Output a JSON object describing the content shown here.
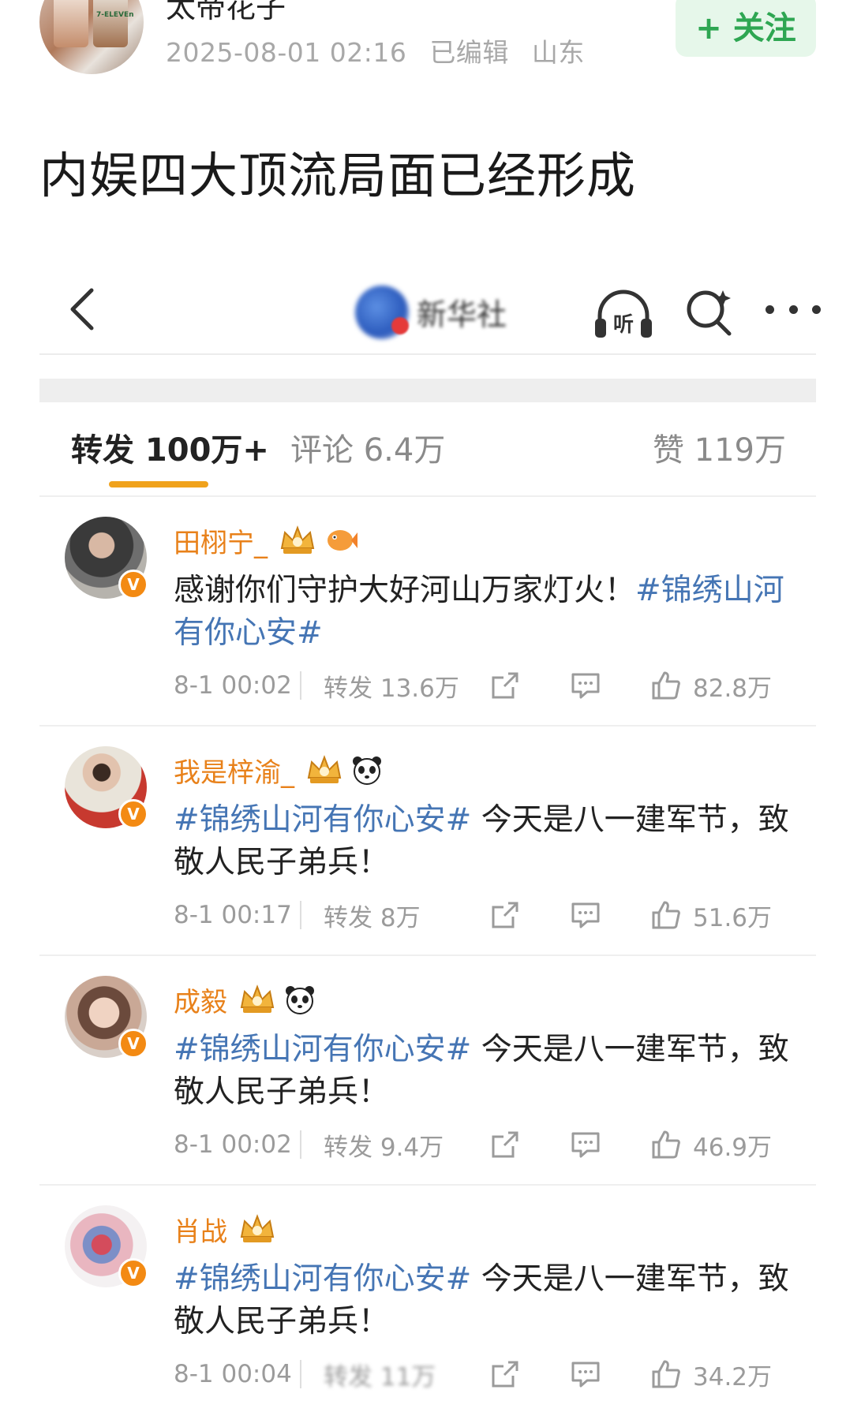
{
  "post": {
    "author_name": "太帝花子",
    "date": "2025-08-01 02:16",
    "edited": "已编辑",
    "location": "山东",
    "follow_label": "+ 关注",
    "title": "内娱四大顶流局面已经形成",
    "avatar_cup_label": "7-ELEVEn"
  },
  "screenshot": {
    "nav": {
      "back_icon": "chevron-left-icon",
      "account_name": "新华社",
      "listen_label": "听",
      "search_icon": "search-sparkle-icon",
      "more_icon": "more-dots-icon"
    },
    "tabs": [
      {
        "label": "转发 100万+",
        "active": true
      },
      {
        "label": "评论 6.4万",
        "active": false
      },
      {
        "label": "赞 119万",
        "active": false
      }
    ],
    "accent_color": "#f0a21c",
    "forwards": [
      {
        "name": "田栩宁_",
        "badges": [
          "crown-icon",
          "fish-icon"
        ],
        "hashtag_first": false,
        "text_before": "感谢你们守护大好河山万家灯火！",
        "hashtag": "#锦绣山河有你心安#",
        "text_after": "",
        "time": "8-1 00:02",
        "reposts": "转发 13.6万",
        "likes": "82.8万"
      },
      {
        "name": "我是梓渝_",
        "badges": [
          "crown-icon",
          "panda-icon"
        ],
        "hashtag_first": true,
        "text_before": "",
        "hashtag": "#锦绣山河有你心安#",
        "text_after": " 今天是八一建军节，致敬人民子弟兵！",
        "time": "8-1 00:17",
        "reposts": "转发 8万",
        "likes": "51.6万"
      },
      {
        "name": "成毅",
        "badges": [
          "crown-icon",
          "panda-icon"
        ],
        "hashtag_first": true,
        "text_before": "",
        "hashtag": "#锦绣山河有你心安#",
        "text_after": " 今天是八一建军节，致敬人民子弟兵！",
        "time": "8-1 00:02",
        "reposts": "转发 9.4万",
        "likes": "46.9万"
      },
      {
        "name": "肖战",
        "badges": [
          "crown-icon"
        ],
        "hashtag_first": true,
        "text_before": "",
        "hashtag": "#锦绣山河有你心安#",
        "text_after": " 今天是八一建军节，致敬人民子弟兵！",
        "time": "8-1 00:04",
        "reposts": "转发 11万",
        "likes": "34.2万"
      }
    ]
  }
}
